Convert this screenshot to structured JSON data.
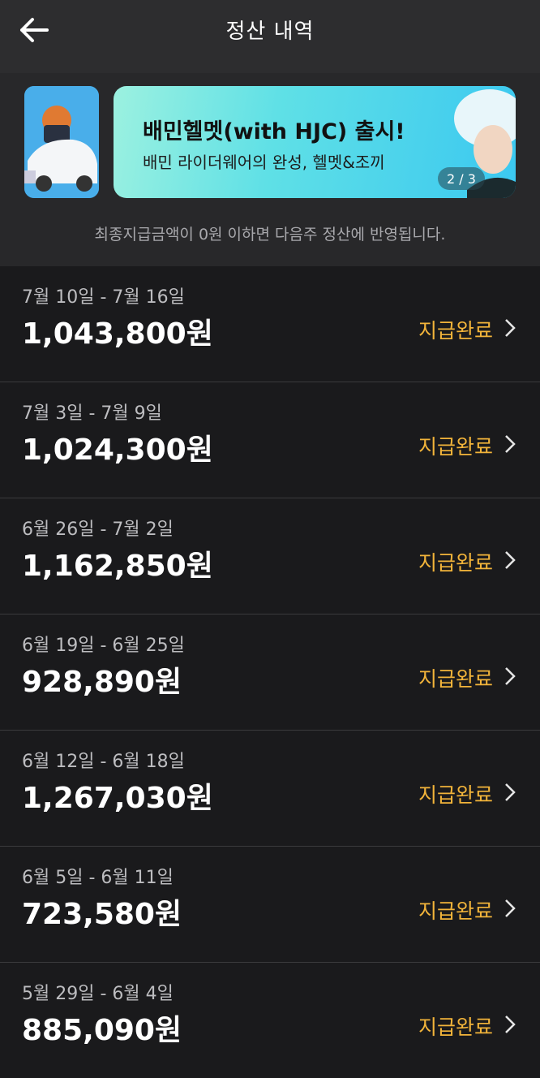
{
  "header": {
    "title": "정산 내역"
  },
  "banner": {
    "title": "배민헬멧(with HJC) 출시!",
    "subtitle": "배민 라이더웨어의 완성, 헬멧&조끼",
    "pager": "2 / 3"
  },
  "notice": "최종지급금액이 0원 이하면 다음주 정산에 반영됩니다.",
  "settlements": [
    {
      "period": "7월 10일 - 7월 16일",
      "amount": "1,043,800원",
      "status": "지급완료"
    },
    {
      "period": "7월 3일 - 7월 9일",
      "amount": "1,024,300원",
      "status": "지급완료"
    },
    {
      "period": "6월 26일 - 7월 2일",
      "amount": "1,162,850원",
      "status": "지급완료"
    },
    {
      "period": "6월 19일 - 6월 25일",
      "amount": "928,890원",
      "status": "지급완료"
    },
    {
      "period": "6월 12일 - 6월 18일",
      "amount": "1,267,030원",
      "status": "지급완료"
    },
    {
      "period": "6월 5일 - 6월 11일",
      "amount": "723,580원",
      "status": "지급완료"
    },
    {
      "period": "5월 29일 - 6월 4일",
      "amount": "885,090원",
      "status": "지급완료"
    }
  ],
  "colors": {
    "status": "#f2b43a",
    "background": "#1a1a1c",
    "header": "#2d2d2f"
  }
}
